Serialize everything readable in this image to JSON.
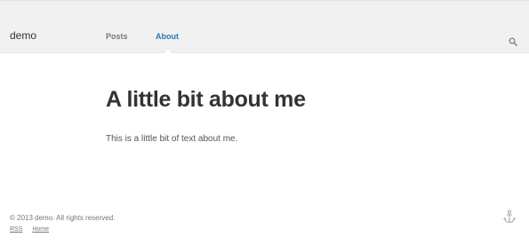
{
  "header": {
    "site_name": "demo",
    "nav": [
      {
        "label": "Posts",
        "active": false
      },
      {
        "label": "About",
        "active": true
      }
    ],
    "search_icon": "search-icon"
  },
  "main": {
    "title": "A little bit about me",
    "body": "This is a little bit of text about me."
  },
  "footer": {
    "copyright": "© 2013 demo. All rights reserved.",
    "links": [
      "RSS",
      "Home"
    ],
    "anchor_icon": "anchor-icon"
  },
  "colors": {
    "accent": "#2a7ab0",
    "header_bg": "#f1f1f1",
    "text": "#333333",
    "muted": "#777777"
  }
}
